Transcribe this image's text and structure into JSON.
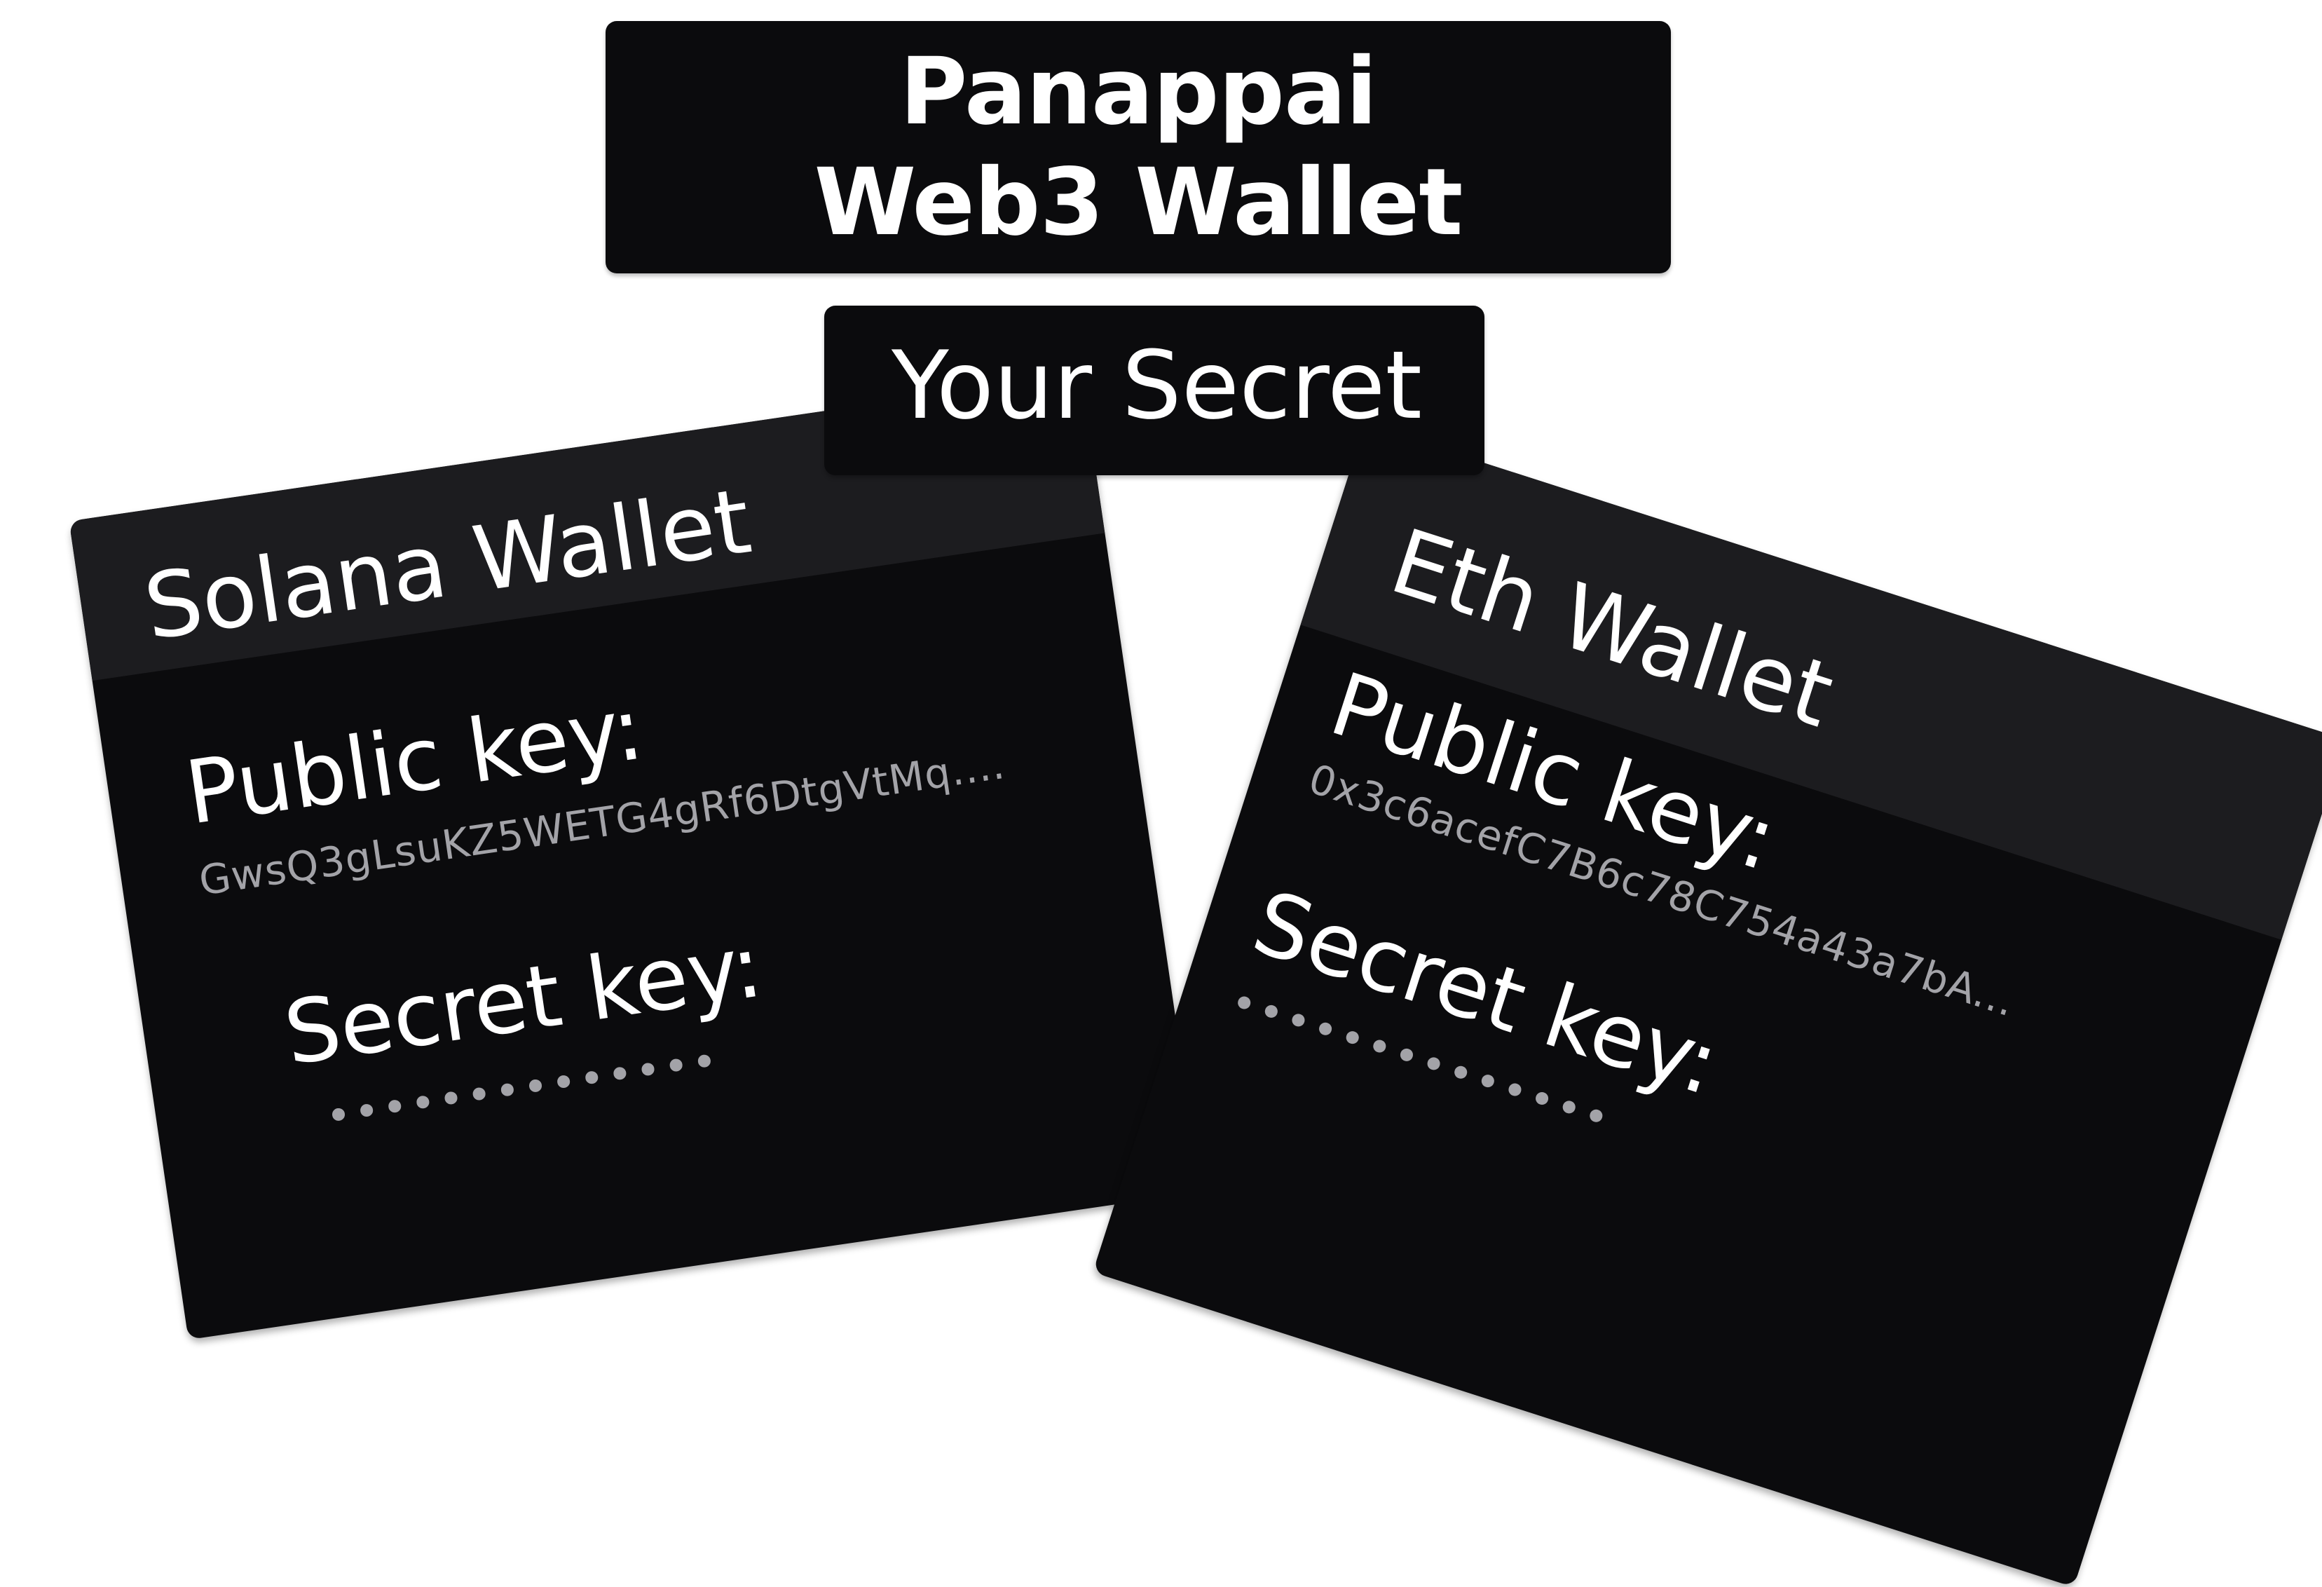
{
  "header": {
    "title_line1": "Panappai",
    "title_line2": "Web3 Wallet"
  },
  "secret_panel": {
    "label": "Your Secret"
  },
  "solana_wallet": {
    "title": "Solana Wallet",
    "public_key_label": "Public key:",
    "public_key_value": "GwsQ3gLsuKZ5WETG4gRf6DtgVtMq....",
    "secret_key_label": "Secret key:",
    "secret_key_masked": "••••••••••••••"
  },
  "eth_wallet": {
    "title": "Eth Wallet",
    "public_key_label": "Public key:",
    "public_key_value": "0x3c6acefC7B6c78C754a43a7bA...",
    "secret_key_label": "Secret key:",
    "secret_key_masked": "••••••••••••••"
  },
  "colors": {
    "panel_background": "#0b0b0d",
    "card_header": "#1c1c1f",
    "text_primary": "#ffffff",
    "text_secondary": "#a3a3a8"
  }
}
